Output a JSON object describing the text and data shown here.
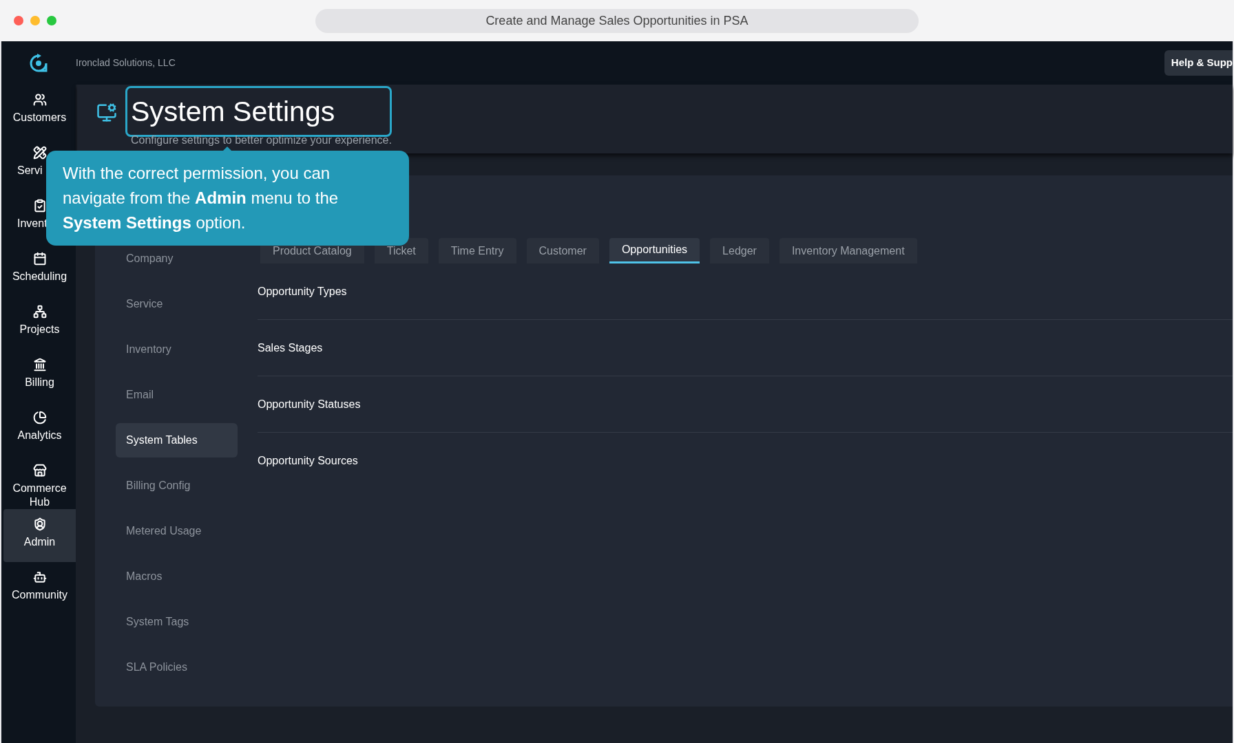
{
  "window": {
    "title": "Create and Manage Sales Opportunities in PSA"
  },
  "header": {
    "company": "Ironclad Solutions, LLC",
    "help_button": "Help & Supp"
  },
  "sidebar": {
    "items": [
      {
        "label": "Customers",
        "selected": false
      },
      {
        "label": "Servi",
        "selected": false,
        "clipped": true
      },
      {
        "label": "Invent",
        "selected": false,
        "clipped": true
      },
      {
        "label": "Scheduling",
        "selected": false
      },
      {
        "label": "Projects",
        "selected": false
      },
      {
        "label": "Billing",
        "selected": false
      },
      {
        "label": "Analytics",
        "selected": false
      },
      {
        "label": "Commerce Hub",
        "selected": false
      },
      {
        "label": "Admin",
        "selected": true
      },
      {
        "label": "Community",
        "selected": false
      }
    ]
  },
  "page": {
    "title": "System Settings",
    "subtitle": "Configure settings to better optimize your experience."
  },
  "tooltip": {
    "text": "With the correct permission, you can navigate from the **Admin** menu to the **System Settings** option."
  },
  "settings_menu": [
    {
      "label": "Company",
      "selected": false
    },
    {
      "label": "Service",
      "selected": false
    },
    {
      "label": "Inventory",
      "selected": false
    },
    {
      "label": "Email",
      "selected": false
    },
    {
      "label": "System Tables",
      "selected": true
    },
    {
      "label": "Billing Config",
      "selected": false
    },
    {
      "label": "Metered Usage",
      "selected": false
    },
    {
      "label": "Macros",
      "selected": false
    },
    {
      "label": "System Tags",
      "selected": false
    },
    {
      "label": "SLA Policies",
      "selected": false
    }
  ],
  "tabs": [
    {
      "label": "Product Catalog",
      "selected": false
    },
    {
      "label": "Ticket",
      "selected": false
    },
    {
      "label": "Time Entry",
      "selected": false
    },
    {
      "label": "Customer",
      "selected": false
    },
    {
      "label": "Opportunities",
      "selected": true
    },
    {
      "label": "Ledger",
      "selected": false
    },
    {
      "label": "Inventory Management",
      "selected": false
    }
  ],
  "rows": [
    "Opportunity Types",
    "Sales Stages",
    "Opportunity Statuses",
    "Opportunity Sources"
  ]
}
